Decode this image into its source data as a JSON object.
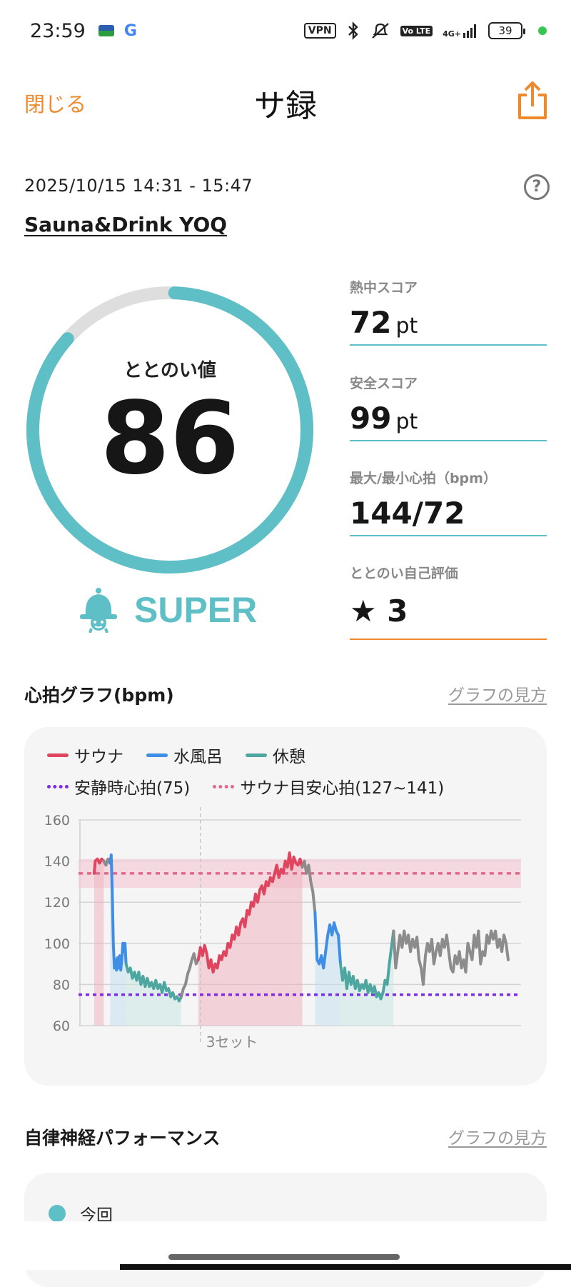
{
  "status_bar": {
    "time": "23:59",
    "vpn": "VPN",
    "network": "4G+",
    "volte": "Vo LTE",
    "battery": "39",
    "icons": [
      "bluetooth-icon",
      "mute-icon",
      "signal-icon"
    ]
  },
  "header": {
    "close_label": "閉じる",
    "title": "サ録",
    "share_icon": "share-icon"
  },
  "session": {
    "date_range": "2025/10/15 14:31 - 15:47",
    "facility": "Sauna&Drink YOQ",
    "help_icon": "help-icon"
  },
  "score": {
    "label": "ととのい値",
    "value": "86",
    "progress": 0.86,
    "grade": "SUPER",
    "grade_icon": "bell-mascot-icon"
  },
  "metrics": [
    {
      "label": "熱中スコア",
      "value": "72",
      "unit": "pt"
    },
    {
      "label": "安全スコア",
      "value": "99",
      "unit": "pt"
    },
    {
      "label": "最大/最小心拍（bpm）",
      "value": "144/72",
      "unit": ""
    },
    {
      "label": "ととのい自己評価",
      "value": "★ 3",
      "unit": ""
    }
  ],
  "heart_section": {
    "title": "心拍グラフ(bpm)",
    "link": "グラフの見方"
  },
  "legend": {
    "sauna": "サウナ",
    "cold_bath": "水風呂",
    "rest": "休憩",
    "resting_hr": "安静時心拍(75)",
    "sauna_target": "サウナ目安心拍(127~141)"
  },
  "colors": {
    "accent": "#5fbfc6",
    "orange": "#ee8a2e",
    "sauna": "#e0455f",
    "cold_bath": "#3f8ee6",
    "rest": "#4ea6a0",
    "other": "#8c8c8c",
    "resting_line": "#7d2ae8",
    "target_line": "#e06a8a"
  },
  "chart_data": {
    "type": "line",
    "ylim": [
      60,
      160
    ],
    "yticks": [
      160,
      140,
      120,
      100,
      80,
      60
    ],
    "resting_hr": 75,
    "target_band": [
      127,
      141
    ],
    "target_mid": 134,
    "set_marker": {
      "x": 100,
      "label": "3セット"
    },
    "segments": [
      {
        "phase": "sauna",
        "points": [
          [
            0,
            134
          ],
          [
            1,
            140
          ],
          [
            3,
            141
          ],
          [
            5,
            139
          ],
          [
            7,
            141
          ],
          [
            9,
            140
          ]
        ]
      },
      {
        "phase": "other",
        "points": [
          [
            9,
            140
          ],
          [
            11,
            138
          ],
          [
            13,
            141
          ],
          [
            15,
            139
          ]
        ]
      },
      {
        "phase": "cold_bath",
        "points": [
          [
            15,
            139
          ],
          [
            16,
            143
          ],
          [
            17,
            125
          ],
          [
            18,
            100
          ],
          [
            19,
            88
          ],
          [
            20,
            92
          ],
          [
            21,
            87
          ],
          [
            22,
            93
          ],
          [
            23,
            88
          ],
          [
            24,
            94
          ],
          [
            25,
            87
          ],
          [
            26,
            92
          ],
          [
            27,
            100
          ],
          [
            28,
            96
          ],
          [
            29,
            100
          ],
          [
            30,
            90
          ]
        ]
      },
      {
        "phase": "rest",
        "points": [
          [
            30,
            90
          ],
          [
            32,
            86
          ],
          [
            34,
            88
          ],
          [
            36,
            83
          ],
          [
            38,
            86
          ],
          [
            40,
            82
          ],
          [
            42,
            86
          ],
          [
            44,
            80
          ],
          [
            46,
            84
          ],
          [
            48,
            79
          ],
          [
            50,
            83
          ],
          [
            52,
            79
          ],
          [
            54,
            81
          ],
          [
            56,
            78
          ],
          [
            58,
            82
          ],
          [
            60,
            78
          ],
          [
            62,
            80
          ],
          [
            64,
            76
          ],
          [
            66,
            81
          ],
          [
            68,
            77
          ],
          [
            70,
            78
          ],
          [
            72,
            74
          ],
          [
            74,
            76
          ],
          [
            76,
            73
          ],
          [
            78,
            74
          ],
          [
            80,
            72
          ],
          [
            82,
            74
          ]
        ]
      },
      {
        "phase": "other",
        "points": [
          [
            82,
            74
          ],
          [
            84,
            78
          ],
          [
            86,
            80
          ],
          [
            88,
            85
          ],
          [
            90,
            88
          ],
          [
            92,
            92
          ],
          [
            94,
            95
          ],
          [
            96,
            90
          ],
          [
            98,
            92
          ]
        ]
      },
      {
        "phase": "sauna",
        "points": [
          [
            98,
            92
          ],
          [
            100,
            98
          ],
          [
            102,
            94
          ],
          [
            104,
            99
          ],
          [
            106,
            95
          ],
          [
            108,
            88
          ],
          [
            110,
            92
          ],
          [
            112,
            86
          ],
          [
            114,
            90
          ],
          [
            116,
            88
          ],
          [
            118,
            94
          ],
          [
            120,
            92
          ],
          [
            122,
            96
          ],
          [
            124,
            94
          ],
          [
            126,
            100
          ],
          [
            128,
            98
          ],
          [
            130,
            104
          ],
          [
            132,
            102
          ],
          [
            134,
            108
          ],
          [
            136,
            104
          ],
          [
            138,
            110
          ],
          [
            140,
            112
          ],
          [
            142,
            108
          ],
          [
            144,
            116
          ],
          [
            146,
            114
          ],
          [
            148,
            120
          ],
          [
            150,
            118
          ],
          [
            152,
            124
          ],
          [
            154,
            120
          ],
          [
            156,
            126
          ],
          [
            158,
            128
          ],
          [
            160,
            124
          ],
          [
            162,
            130
          ],
          [
            164,
            128
          ],
          [
            166,
            132
          ],
          [
            168,
            130
          ],
          [
            170,
            134
          ],
          [
            172,
            138
          ],
          [
            174,
            132
          ],
          [
            176,
            136
          ],
          [
            178,
            134
          ],
          [
            180,
            140
          ],
          [
            182,
            137
          ],
          [
            184,
            144
          ],
          [
            186,
            136
          ],
          [
            188,
            142
          ],
          [
            190,
            139
          ],
          [
            192,
            138
          ],
          [
            194,
            141
          ],
          [
            196,
            137
          ]
        ]
      },
      {
        "phase": "other",
        "points": [
          [
            196,
            137
          ],
          [
            198,
            140
          ],
          [
            200,
            134
          ],
          [
            202,
            138
          ],
          [
            204,
            130
          ],
          [
            206,
            125
          ],
          [
            208,
            115
          ]
        ]
      },
      {
        "phase": "cold_bath",
        "points": [
          [
            208,
            115
          ],
          [
            210,
            92
          ],
          [
            212,
            90
          ],
          [
            214,
            94
          ],
          [
            216,
            88
          ],
          [
            218,
            96
          ],
          [
            220,
            104
          ],
          [
            222,
            109
          ],
          [
            224,
            104
          ],
          [
            226,
            110
          ],
          [
            228,
            106
          ],
          [
            230,
            104
          ],
          [
            232,
            90
          ]
        ]
      },
      {
        "phase": "rest",
        "points": [
          [
            232,
            90
          ],
          [
            234,
            82
          ],
          [
            236,
            88
          ],
          [
            238,
            78
          ],
          [
            240,
            86
          ],
          [
            242,
            80
          ],
          [
            244,
            84
          ],
          [
            246,
            78
          ],
          [
            248,
            82
          ],
          [
            250,
            77
          ],
          [
            252,
            80
          ],
          [
            254,
            78
          ],
          [
            256,
            82
          ],
          [
            258,
            76
          ],
          [
            260,
            80
          ],
          [
            262,
            76
          ],
          [
            264,
            79
          ],
          [
            266,
            74
          ],
          [
            268,
            76
          ],
          [
            270,
            73
          ],
          [
            272,
            76
          ],
          [
            274,
            82
          ],
          [
            276,
            80
          ],
          [
            278,
            90
          ],
          [
            280,
            98
          ],
          [
            282,
            106
          ]
        ]
      },
      {
        "phase": "other",
        "points": [
          [
            282,
            106
          ],
          [
            284,
            88
          ],
          [
            286,
            96
          ],
          [
            288,
            104
          ],
          [
            290,
            98
          ],
          [
            292,
            106
          ],
          [
            294,
            100
          ],
          [
            296,
            104
          ],
          [
            298,
            96
          ],
          [
            300,
            102
          ],
          [
            302,
            98
          ],
          [
            304,
            103
          ],
          [
            306,
            92
          ],
          [
            308,
            88
          ],
          [
            310,
            80
          ],
          [
            312,
            94
          ],
          [
            314,
            100
          ],
          [
            316,
            96
          ],
          [
            318,
            102
          ],
          [
            320,
            90
          ],
          [
            322,
            96
          ],
          [
            324,
            100
          ],
          [
            326,
            94
          ],
          [
            328,
            102
          ],
          [
            330,
            98
          ],
          [
            332,
            104
          ],
          [
            334,
            96
          ],
          [
            336,
            88
          ],
          [
            338,
            86
          ],
          [
            340,
            94
          ],
          [
            342,
            90
          ],
          [
            344,
            96
          ],
          [
            346,
            88
          ],
          [
            348,
            92
          ],
          [
            350,
            86
          ],
          [
            352,
            100
          ],
          [
            354,
            96
          ],
          [
            356,
            92
          ],
          [
            358,
            104
          ],
          [
            360,
            98
          ],
          [
            362,
            106
          ],
          [
            364,
            90
          ],
          [
            366,
            96
          ],
          [
            368,
            94
          ],
          [
            370,
            104
          ],
          [
            372,
            100
          ],
          [
            374,
            106
          ],
          [
            376,
            102
          ],
          [
            378,
            106
          ],
          [
            380,
            98
          ],
          [
            382,
            102
          ],
          [
            384,
            96
          ],
          [
            386,
            104
          ],
          [
            388,
            100
          ],
          [
            390,
            92
          ]
        ]
      }
    ]
  },
  "anf_section": {
    "title": "自律神経パフォーマンス",
    "link": "グラフの見方",
    "legend_current": "今回"
  }
}
